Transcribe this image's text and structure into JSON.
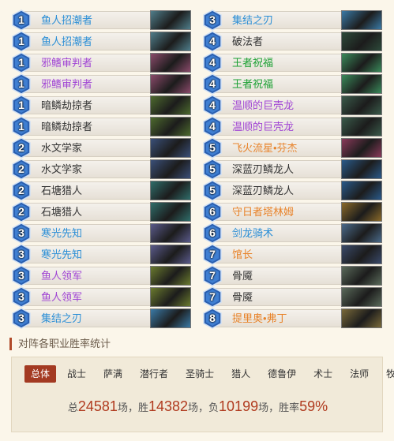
{
  "deck": {
    "left": [
      {
        "cost": "1",
        "name": "鱼人招潮者",
        "rarity": "rare",
        "art": "#4f7d8a"
      },
      {
        "cost": "1",
        "name": "鱼人招潮者",
        "rarity": "rare",
        "art": "#4f7d8a"
      },
      {
        "cost": "1",
        "name": "邪鳍审判者",
        "rarity": "epic",
        "art": "#8a4a6a"
      },
      {
        "cost": "1",
        "name": "邪鳍审判者",
        "rarity": "epic",
        "art": "#8a4a6a"
      },
      {
        "cost": "1",
        "name": "暗鳞劫掠者",
        "rarity": "common",
        "art": "#4d6a2e"
      },
      {
        "cost": "1",
        "name": "暗鳞劫掠者",
        "rarity": "common",
        "art": "#4d6a2e"
      },
      {
        "cost": "2",
        "name": "水文学家",
        "rarity": "common",
        "art": "#3a4f78"
      },
      {
        "cost": "2",
        "name": "水文学家",
        "rarity": "common",
        "art": "#3a4f78"
      },
      {
        "cost": "2",
        "name": "石塘猎人",
        "rarity": "common",
        "art": "#2f6d6a"
      },
      {
        "cost": "2",
        "name": "石塘猎人",
        "rarity": "common",
        "art": "#2f6d6a"
      },
      {
        "cost": "3",
        "name": "寒光先知",
        "rarity": "rare",
        "art": "#5a5a8a"
      },
      {
        "cost": "3",
        "name": "寒光先知",
        "rarity": "rare",
        "art": "#5a5a8a"
      },
      {
        "cost": "3",
        "name": "鱼人领军",
        "rarity": "epic",
        "art": "#6a7a2e"
      },
      {
        "cost": "3",
        "name": "鱼人领军",
        "rarity": "epic",
        "art": "#6a7a2e"
      },
      {
        "cost": "3",
        "name": "集结之刃",
        "rarity": "rare",
        "art": "#3a7aa6"
      }
    ],
    "right": [
      {
        "cost": "3",
        "name": "集结之刃",
        "rarity": "rare",
        "art": "#3a7aa6"
      },
      {
        "cost": "4",
        "name": "破法者",
        "rarity": "common",
        "art": "#2d4a3a"
      },
      {
        "cost": "4",
        "name": "王者祝福",
        "rarity": "free",
        "art": "#3a8a5a"
      },
      {
        "cost": "4",
        "name": "王者祝福",
        "rarity": "free",
        "art": "#3a8a5a"
      },
      {
        "cost": "4",
        "name": "温顺的巨壳龙",
        "rarity": "epic",
        "art": "#3a5a4a"
      },
      {
        "cost": "4",
        "name": "温顺的巨壳龙",
        "rarity": "epic",
        "art": "#3a5a4a"
      },
      {
        "cost": "5",
        "name": "飞火流星•芬杰",
        "rarity": "legendary",
        "art": "#8a3a5a"
      },
      {
        "cost": "5",
        "name": "深蓝刃鳞龙人",
        "rarity": "common",
        "art": "#2a5a8a"
      },
      {
        "cost": "5",
        "name": "深蓝刃鳞龙人",
        "rarity": "common",
        "art": "#2a5a8a"
      },
      {
        "cost": "6",
        "name": "守日者塔林姆",
        "rarity": "legendary",
        "art": "#8a6a2a"
      },
      {
        "cost": "6",
        "name": "剑龙骑术",
        "rarity": "rare",
        "art": "#4a6a8a"
      },
      {
        "cost": "7",
        "name": "馆长",
        "rarity": "legendary",
        "art": "#3a4a6a"
      },
      {
        "cost": "7",
        "name": "骨魇",
        "rarity": "common",
        "art": "#5a6a5a"
      },
      {
        "cost": "7",
        "name": "骨魇",
        "rarity": "common",
        "art": "#5a6a5a"
      },
      {
        "cost": "8",
        "name": "提里奥•弗丁",
        "rarity": "legendary",
        "art": "#7a6a3a"
      }
    ]
  },
  "stats": {
    "title": "对阵各职业胜率统计",
    "tabs": [
      "总体",
      "战士",
      "萨满",
      "潜行者",
      "圣骑士",
      "猎人",
      "德鲁伊",
      "术士",
      "法师",
      "牧师"
    ],
    "active_tab": 0,
    "summary": {
      "prefix": "总",
      "total": "24581",
      "games_unit_1": "场，胜",
      "wins": "14382",
      "games_unit_2": "场，负",
      "losses": "10199",
      "games_unit_3": "场，胜率",
      "winrate": "59%"
    }
  },
  "colors": {
    "common": "#333333",
    "rare": "#2a8ed6",
    "epic": "#a044d4",
    "legendary": "#e8832a",
    "free": "#1aa032",
    "accent": "#a33a22",
    "gem": "#2a5fb0"
  }
}
